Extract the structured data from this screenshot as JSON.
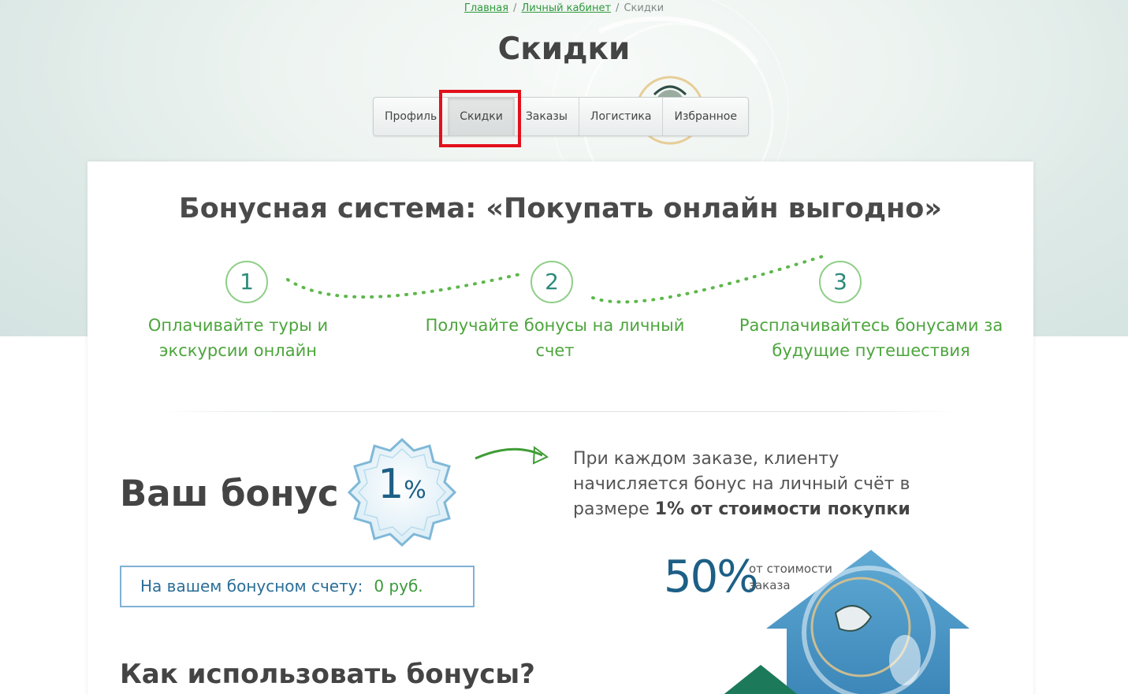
{
  "breadcrumb": {
    "home": "Главная",
    "cabinet": "Личный кабинет",
    "current": "Скидки",
    "separator": "/"
  },
  "page": {
    "title": "Скидки"
  },
  "tabs": [
    {
      "label": "Профиль",
      "active": false
    },
    {
      "label": "Скидки",
      "active": true
    },
    {
      "label": "Заказы",
      "active": false
    },
    {
      "label": "Логистика",
      "active": false
    },
    {
      "label": "Избранное",
      "active": false
    }
  ],
  "bonus_system": {
    "title": "Бонусная система: «Покупать онлайн выгодно»",
    "steps": [
      {
        "number": "1",
        "text_line1": "Оплачивайте туры и",
        "text_line2": "экскурсии онлайн"
      },
      {
        "number": "2",
        "text_line1": "Получайте бонусы на личный",
        "text_line2": "счет"
      },
      {
        "number": "3",
        "text_line1": "Расплачивайтесь бонусами за",
        "text_line2": "будущие путешествия"
      }
    ]
  },
  "your_bonus": {
    "heading": "Ваш бонус",
    "badge_value": "1",
    "badge_unit": "%",
    "info_line1": "При каждом заказе, клиенту",
    "info_line2": "начисляется бонус на личный счёт в",
    "info_line3_prefix": "размере ",
    "info_line3_bold": "1% от стоимости покупки"
  },
  "account": {
    "label": "На вашем бонусном счету:",
    "value": "0 руб."
  },
  "usage": {
    "title": "Как использовать бонусы?",
    "percent": "50%",
    "percent_label_line1": "от стоимости",
    "percent_label_line2": "заказа"
  },
  "colors": {
    "accent_green": "#4ca53c",
    "link_green": "#2e9a3c",
    "blue": "#1d5f86",
    "highlight_red": "#e3101a"
  }
}
